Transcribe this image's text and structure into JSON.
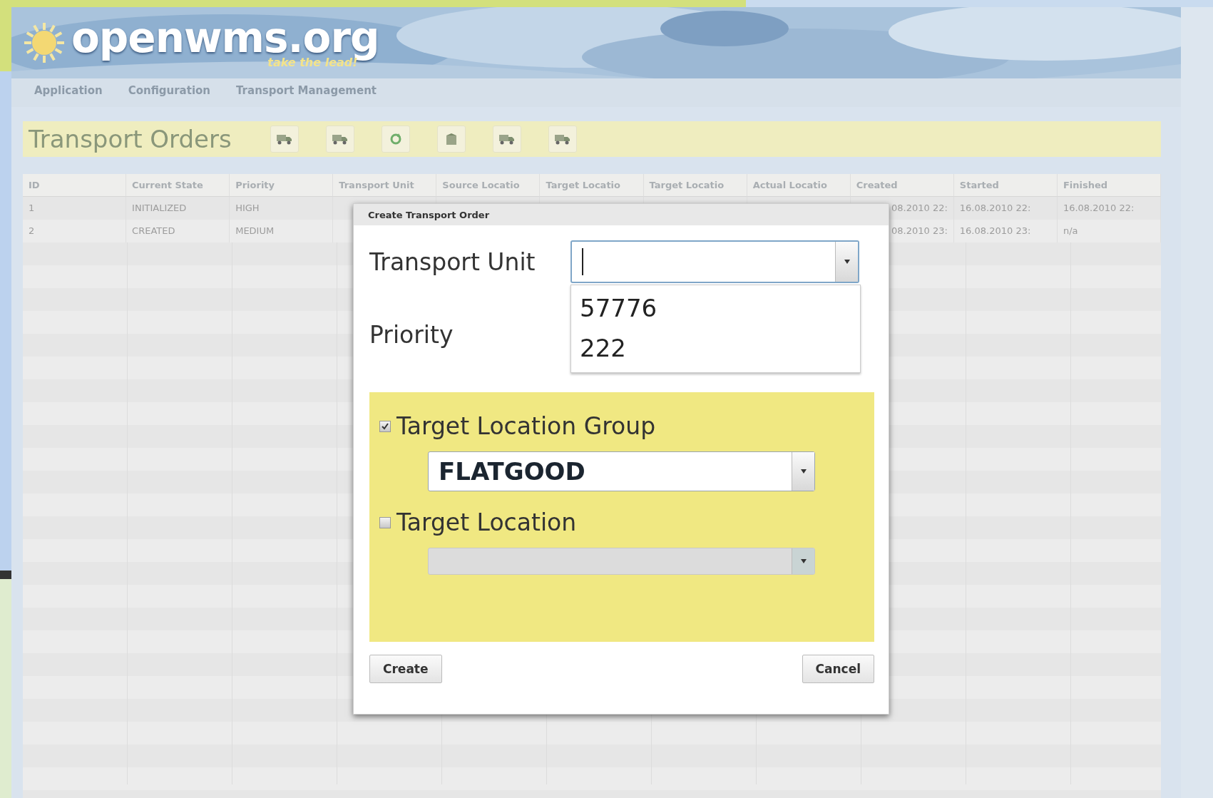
{
  "header": {
    "logo": "openwms.org",
    "tagline": "take the lead!"
  },
  "menu": [
    {
      "label": "Application"
    },
    {
      "label": "Configuration"
    },
    {
      "label": "Transport Management"
    }
  ],
  "page_title": "Transport Orders",
  "toolbar": [
    {
      "kind": "truck"
    },
    {
      "kind": "truck"
    },
    {
      "kind": "refresh"
    },
    {
      "kind": "crate"
    },
    {
      "kind": "truck"
    },
    {
      "kind": "truck"
    }
  ],
  "table": {
    "columns": [
      "ID",
      "Current State",
      "Priority",
      "Transport Unit",
      "Source Locatio",
      "Target Locatio",
      "Target Locatio",
      "Actual Locatio",
      "Created",
      "Started",
      "Finished"
    ],
    "rows": [
      {
        "id": "1",
        "current_state": "INITIALIZED",
        "priority": "HIGH",
        "created": "08.2010 22:",
        "started": "16.08.2010 22:",
        "finished": "16.08.2010 22:"
      },
      {
        "id": "2",
        "current_state": "CREATED",
        "priority": "MEDIUM",
        "created": "08.2010 23:",
        "started": "16.08.2010 23:",
        "finished": "n/a"
      }
    ]
  },
  "dialog": {
    "title": "Create Transport Order",
    "transport_unit": {
      "label": "Transport Unit",
      "expanded": true,
      "options": [
        "57776",
        "222"
      ]
    },
    "priority": {
      "label": "Priority"
    },
    "target_group": {
      "label": "Target Location Group",
      "checked": true,
      "value": "FLATGOOD"
    },
    "target_location": {
      "label": "Target Location",
      "checked": false,
      "disabled": true
    },
    "buttons": [
      {
        "label": "Create"
      },
      {
        "label": "Cancel"
      }
    ]
  }
}
